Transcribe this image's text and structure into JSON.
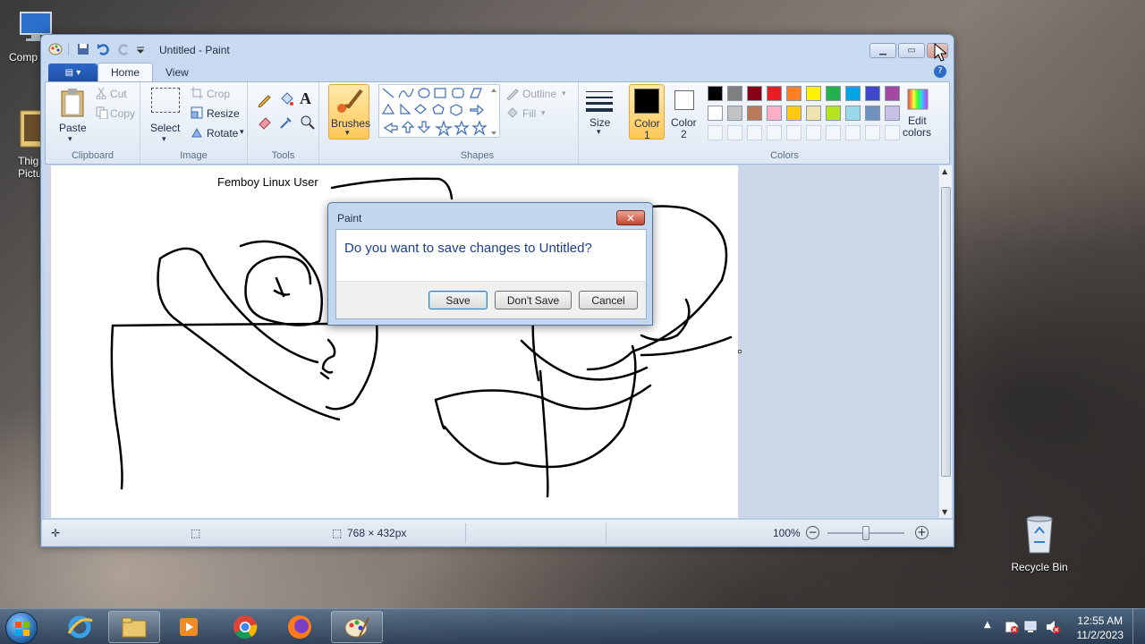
{
  "desktop": {
    "icons": [
      {
        "label": "Comp",
        "icon": "computer-icon"
      },
      {
        "label": "Thig\nPictu",
        "icon": "folder-pictures-icon"
      },
      {
        "label": "Recycle Bin",
        "icon": "recycle-bin-icon"
      }
    ]
  },
  "window": {
    "title": "Untitled - Paint",
    "tabs": [
      "Home",
      "View"
    ],
    "active_tab": "Home",
    "ribbon": {
      "clipboard": {
        "label": "Clipboard",
        "paste": "Paste",
        "cut": "Cut",
        "copy": "Copy"
      },
      "image": {
        "label": "Image",
        "select": "Select",
        "crop": "Crop",
        "resize": "Resize",
        "rotate": "Rotate"
      },
      "tools": {
        "label": "Tools"
      },
      "brushes": {
        "label": "Brushes"
      },
      "shapes": {
        "label": "Shapes",
        "outline": "Outline",
        "fill": "Fill"
      },
      "size": {
        "label": "Size"
      },
      "colors": {
        "label": "Colors",
        "color1_label": "Color",
        "color1_num": "1",
        "color2_label": "Color",
        "color2_num": "2",
        "color1_value": "#000000",
        "color2_value": "#ffffff",
        "edit": "Edit",
        "edit2": "colors",
        "palette_row1": [
          "#000000",
          "#7f7f7f",
          "#880015",
          "#ed1c24",
          "#ff7f27",
          "#fff200",
          "#22b14c",
          "#00a2e8",
          "#3f48cc",
          "#a349a4"
        ],
        "palette_row2": [
          "#ffffff",
          "#c3c3c3",
          "#b97a57",
          "#ffaec9",
          "#ffc90e",
          "#efe4b0",
          "#b5e61d",
          "#99d9ea",
          "#7092be",
          "#c8bfe7"
        ]
      }
    },
    "canvas_text": "Femboy Linux User",
    "status": {
      "dimensions": "768 × 432px",
      "zoom": "100%",
      "zoom_level_percent": 100
    }
  },
  "dialog": {
    "title": "Paint",
    "message": "Do you want to save changes to Untitled?",
    "buttons": {
      "save": "Save",
      "dont_save": "Don't Save",
      "cancel": "Cancel"
    }
  },
  "taskbar": {
    "apps": [
      "internet-explorer-icon",
      "file-explorer-icon",
      "media-player-icon",
      "chrome-icon",
      "firefox-icon",
      "paint-icon"
    ],
    "time": "12:55 AM",
    "date": "11/2/2023"
  }
}
